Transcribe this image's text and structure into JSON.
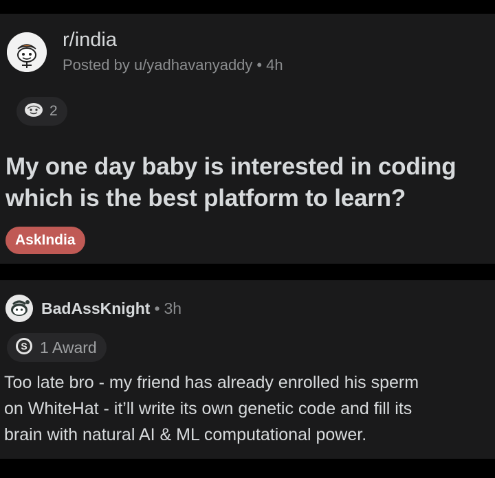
{
  "post": {
    "subreddit": "r/india",
    "posted_by": "Posted by u/yadhavanyaddy",
    "time": "4h",
    "award_count": "2",
    "award_icon": "silver-award-icon",
    "title": "My one day baby is interested in coding which is the best platform to learn?",
    "flair": "AskIndia",
    "flair_color": "#c05a55"
  },
  "comment": {
    "username": "BadAssKnight",
    "time": "3h",
    "award_label": "1 Award",
    "award_icon": "award-s-icon",
    "body_lines": [
      "Too late bro - my friend has already enrolled his sperm",
      "on WhiteHat - it’ll write its own genetic code and fill its",
      "brain with natural AI & ML computational power."
    ]
  },
  "colors": {
    "background": "#000000",
    "card": "#1a1a1b",
    "text": "#d7dadc",
    "muted": "#8a8c8e"
  }
}
